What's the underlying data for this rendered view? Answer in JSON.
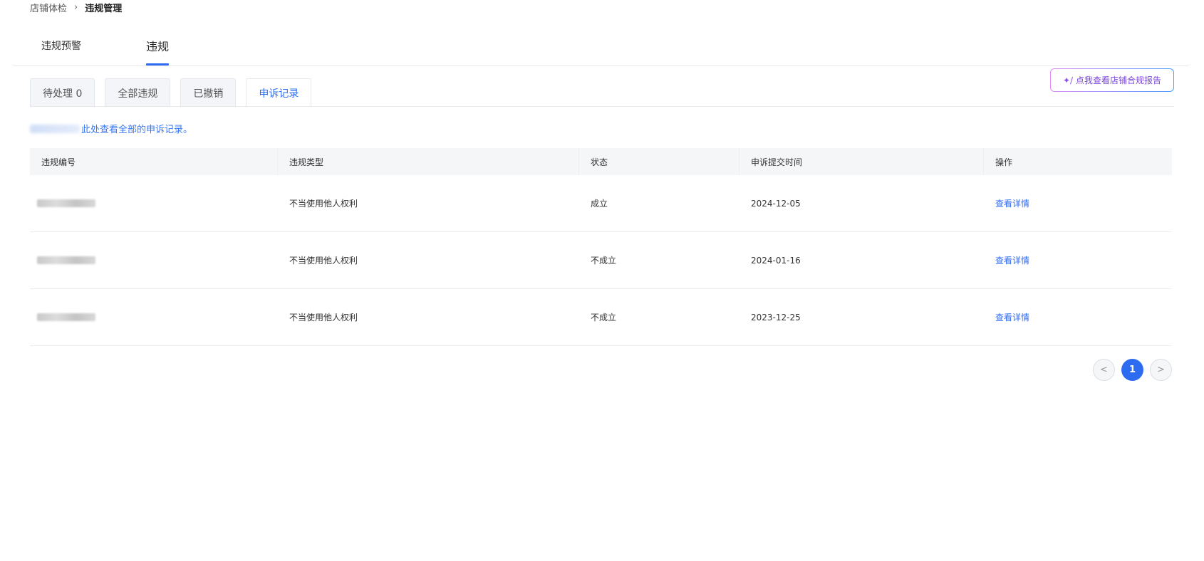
{
  "breadcrumb": {
    "parent": "店铺体检",
    "separator": "›",
    "current": "违规管理"
  },
  "main_tabs": [
    {
      "label": "违规预警"
    },
    {
      "label": "违规",
      "active": true
    }
  ],
  "report_button": {
    "label": "点我查看店铺合规报告",
    "icon": "sparkle-pen-icon"
  },
  "sub_tabs": [
    {
      "label": "待处理 0"
    },
    {
      "label": "全部违规"
    },
    {
      "label": "已撤销"
    },
    {
      "label": "申诉记录",
      "active": true
    }
  ],
  "hint": {
    "text": "此处查看全部的申诉记录。"
  },
  "table": {
    "headers": [
      "违规编号",
      "违规类型",
      "状态",
      "申诉提交时间",
      "操作"
    ],
    "rows": [
      {
        "id": "",
        "type": "不当使用他人权利",
        "status": "成立",
        "time": "2024-12-05",
        "action": "查看详情"
      },
      {
        "id": "",
        "type": "不当使用他人权利",
        "status": "不成立",
        "time": "2024-01-16",
        "action": "查看详情"
      },
      {
        "id": "",
        "type": "不当使用他人权利",
        "status": "不成立",
        "time": "2023-12-25",
        "action": "查看详情"
      }
    ]
  },
  "pagination": {
    "prev": "<",
    "current": "1",
    "next": ">"
  },
  "colors": {
    "accent": "#2d6cf0",
    "report_border_start": "#e08cf4",
    "report_border_end": "#4a9cff"
  }
}
